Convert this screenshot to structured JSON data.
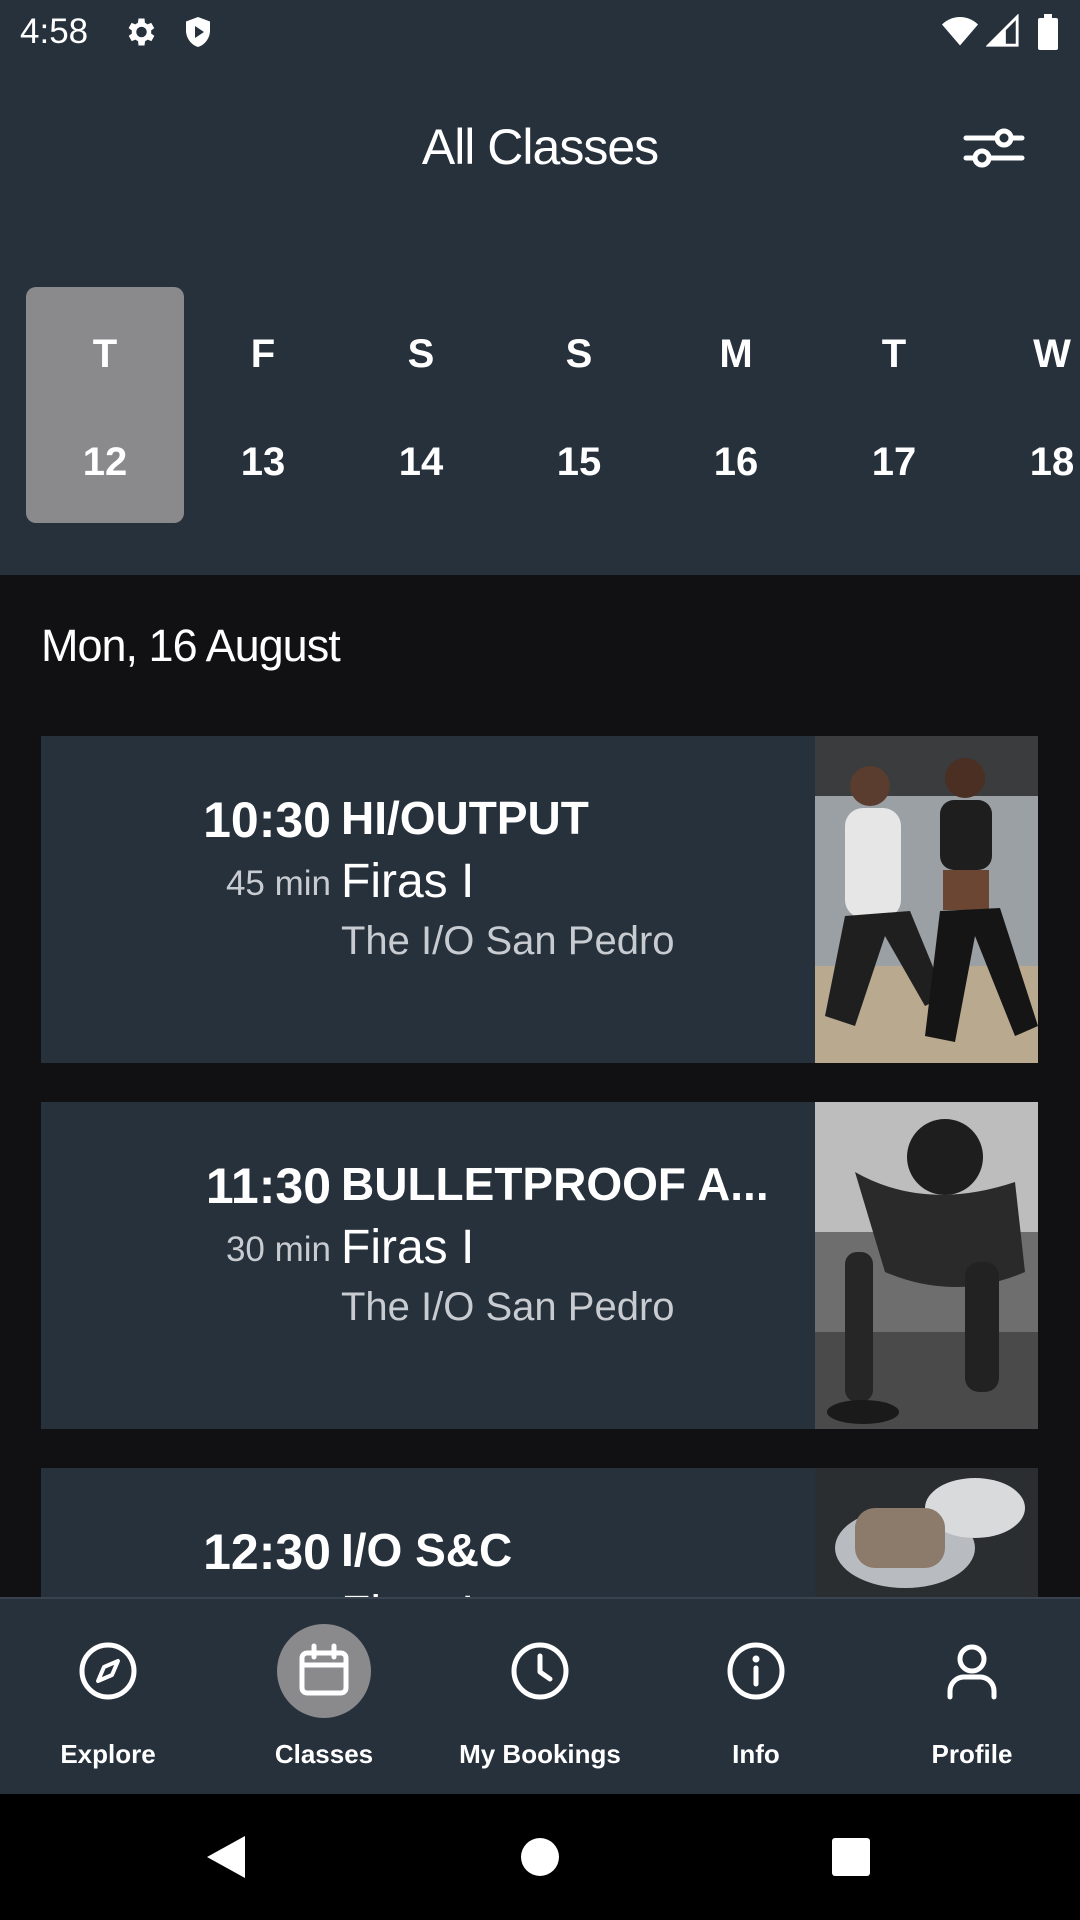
{
  "status_bar": {
    "time": "4:58"
  },
  "header": {
    "title": "All Classes"
  },
  "dates": [
    {
      "dow": "T",
      "day": "12",
      "selected": true
    },
    {
      "dow": "F",
      "day": "13"
    },
    {
      "dow": "S",
      "day": "14"
    },
    {
      "dow": "S",
      "day": "15"
    },
    {
      "dow": "M",
      "day": "16"
    },
    {
      "dow": "T",
      "day": "17"
    },
    {
      "dow": "W",
      "day": "18"
    }
  ],
  "list": {
    "date_heading": "Mon, 16 August",
    "classes": [
      {
        "time": "10:30",
        "duration": "45 min",
        "name": "HI/OUTPUT",
        "instructor": "Firas I",
        "location": "The I/O San Pedro"
      },
      {
        "time": "11:30",
        "duration": "30 min",
        "name": "BULLETPROOF A...",
        "instructor": "Firas I",
        "location": "The I/O San Pedro"
      },
      {
        "time": "12:30",
        "duration": "",
        "name": "I/O S&C",
        "instructor": "Firas I",
        "location": ""
      }
    ]
  },
  "nav": {
    "items": [
      {
        "label": "Explore",
        "icon": "compass-icon"
      },
      {
        "label": "Classes",
        "icon": "calendar-icon",
        "active": true
      },
      {
        "label": "My Bookings",
        "icon": "clock-icon"
      },
      {
        "label": "Info",
        "icon": "info-icon"
      },
      {
        "label": "Profile",
        "icon": "person-icon"
      }
    ]
  },
  "colors": {
    "header_bg": "#27313c",
    "card_bg": "#27313c",
    "page_bg": "#111113",
    "selected_bg": "#8a8a8c"
  }
}
